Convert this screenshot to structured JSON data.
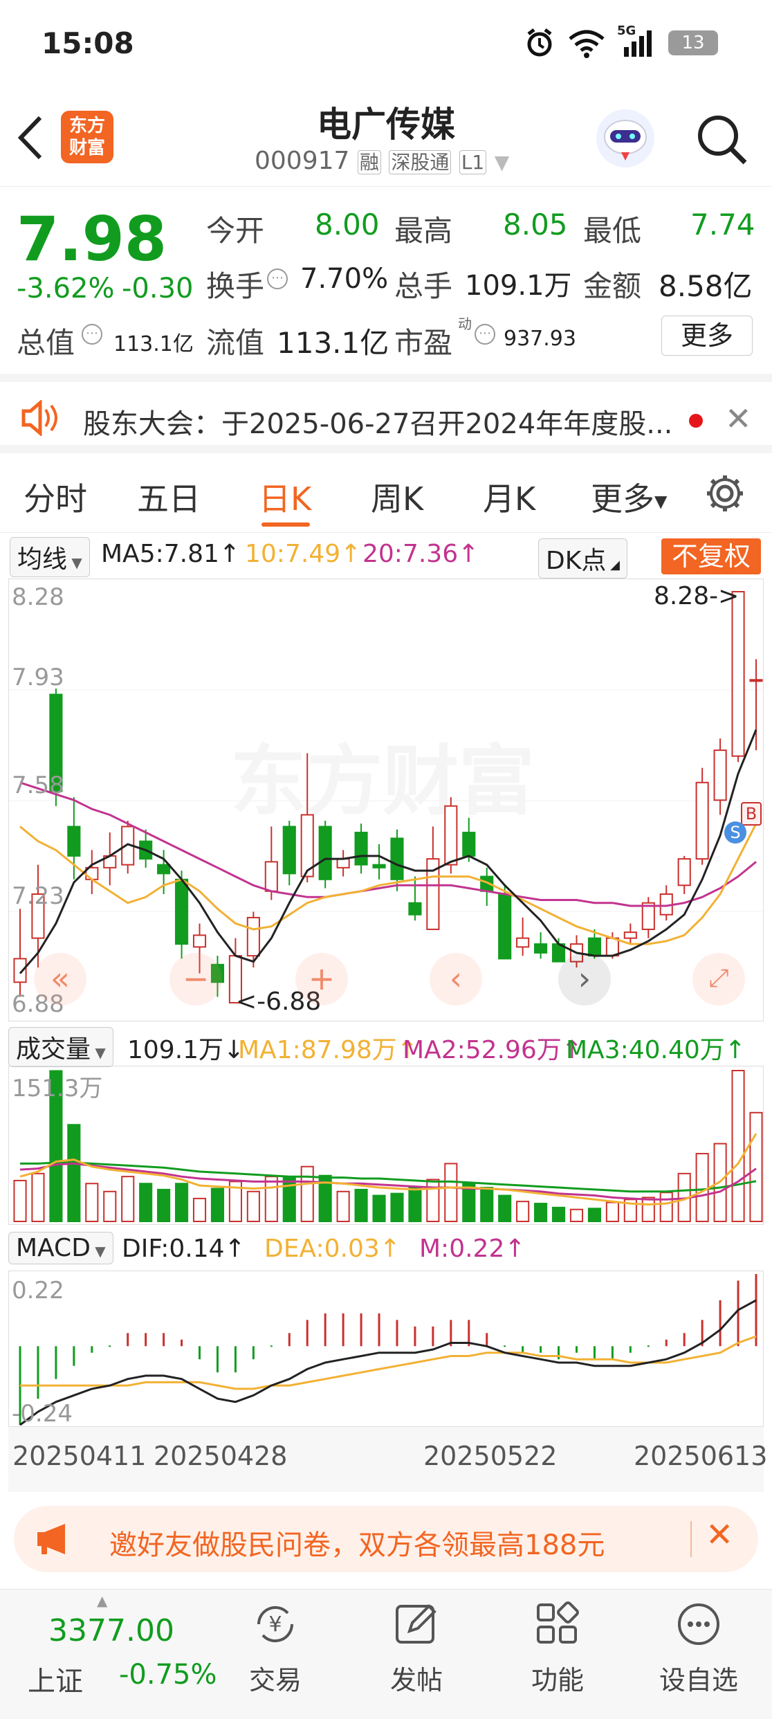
{
  "status_bar": {
    "time": "15:08",
    "battery": "13",
    "network": "5G"
  },
  "header": {
    "title": "电广传媒",
    "code": "000917",
    "tags": [
      "融",
      "深股通",
      "L1"
    ],
    "logo_text": "东方财富"
  },
  "quote": {
    "price": "7.98",
    "change_pct": "-3.62%",
    "change": "-0.30",
    "open_label": "今开",
    "open": "8.00",
    "high_label": "最高",
    "high": "8.05",
    "low_label": "最低",
    "low": "7.74",
    "turnover_label": "换手",
    "turnover": "7.70%",
    "volume_label": "总手",
    "volume": "109.1万",
    "amount_label": "金额",
    "amount": "8.58亿",
    "mktcap_label": "总值",
    "mktcap": "113.1亿",
    "float_label": "流值",
    "float": "113.1亿",
    "pe_label": "市盈",
    "pe_sup": "动",
    "pe": "937.93",
    "more_button": "更多"
  },
  "notice": {
    "text": "股东大会：于2025-06-27召开2024年年度股..."
  },
  "tabs": {
    "items": [
      "分时",
      "五日",
      "日K",
      "周K",
      "月K",
      "更多"
    ],
    "active": "日K"
  },
  "kline": {
    "ma_select": "均线",
    "ma5": "MA5:7.81↑",
    "ma10": "10:7.49↑",
    "ma20": "20:7.36↑",
    "dk_select": "DK点",
    "fq_button": "不复权",
    "y_labels": [
      "8.28",
      "7.93",
      "7.58",
      "7.23",
      "6.88"
    ],
    "max_marker": "8.28->",
    "min_marker": "<-6.88",
    "watermark": "东方财富",
    "b_mark": "B",
    "s_mark": "S"
  },
  "volume": {
    "select": "成交量",
    "value": "109.1万↓",
    "ma1": "MA1:87.98万↑",
    "ma2": "MA2:52.96万↑",
    "ma3": "MA3:40.40万↑",
    "ymax": "151.3万"
  },
  "macd": {
    "select": "MACD",
    "dif": "DIF:0.14↑",
    "dea": "DEA:0.03↑",
    "m": "M:0.22↑",
    "ymax": "0.22",
    "ymin": "-0.24"
  },
  "dates": [
    "20250411",
    "20250428",
    "20250522",
    "20250613"
  ],
  "banner": {
    "text": "邀好友做股民问卷，双方各领最高188元"
  },
  "bottom": {
    "index_value": "3377.00",
    "index_name": "上证",
    "index_change": "-0.75%",
    "items": [
      "交易",
      "发帖",
      "功能",
      "设自选"
    ]
  },
  "colors": {
    "up": "#c9302c",
    "down": "#119c1f",
    "accent": "#f26522",
    "ma5": "#222222",
    "ma10": "#f2b134",
    "ma20": "#c2338f"
  },
  "chart_data": {
    "type": "candlestick",
    "ylim": [
      6.88,
      8.28
    ],
    "candles": [
      {
        "o": 6.95,
        "c": 7.03,
        "h": 7.2,
        "l": 6.9
      },
      {
        "o": 7.1,
        "c": 7.25,
        "h": 7.35,
        "l": 7.0
      },
      {
        "o": 7.93,
        "c": 7.6,
        "h": 7.95,
        "l": 7.55
      },
      {
        "o": 7.48,
        "c": 7.38,
        "h": 7.58,
        "l": 7.3
      },
      {
        "o": 7.3,
        "c": 7.34,
        "h": 7.4,
        "l": 7.25
      },
      {
        "o": 7.34,
        "c": 7.38,
        "h": 7.46,
        "l": 7.28
      },
      {
        "o": 7.35,
        "c": 7.48,
        "h": 7.5,
        "l": 7.32
      },
      {
        "o": 7.43,
        "c": 7.37,
        "h": 7.47,
        "l": 7.34
      },
      {
        "o": 7.35,
        "c": 7.32,
        "h": 7.4,
        "l": 7.25
      },
      {
        "o": 7.3,
        "c": 7.08,
        "h": 7.33,
        "l": 7.03
      },
      {
        "o": 7.07,
        "c": 7.11,
        "h": 7.15,
        "l": 6.98
      },
      {
        "o": 7.01,
        "c": 6.95,
        "h": 7.04,
        "l": 6.9
      },
      {
        "o": 6.88,
        "c": 7.04,
        "h": 7.1,
        "l": 6.88
      },
      {
        "o": 7.04,
        "c": 7.17,
        "h": 7.19,
        "l": 7.0
      },
      {
        "o": 7.26,
        "c": 7.36,
        "h": 7.48,
        "l": 7.23
      },
      {
        "o": 7.48,
        "c": 7.32,
        "h": 7.5,
        "l": 7.28
      },
      {
        "o": 7.31,
        "c": 7.52,
        "h": 7.73,
        "l": 7.29
      },
      {
        "o": 7.48,
        "c": 7.3,
        "h": 7.5,
        "l": 7.27
      },
      {
        "o": 7.34,
        "c": 7.37,
        "h": 7.4,
        "l": 7.31
      },
      {
        "o": 7.46,
        "c": 7.35,
        "h": 7.49,
        "l": 7.32
      },
      {
        "o": 7.35,
        "c": 7.34,
        "h": 7.42,
        "l": 7.3
      },
      {
        "o": 7.44,
        "c": 7.3,
        "h": 7.47,
        "l": 7.26
      },
      {
        "o": 7.22,
        "c": 7.18,
        "h": 7.31,
        "l": 7.16
      },
      {
        "o": 7.13,
        "c": 7.37,
        "h": 7.48,
        "l": 7.13
      },
      {
        "o": 7.35,
        "c": 7.55,
        "h": 7.58,
        "l": 7.32
      },
      {
        "o": 7.46,
        "c": 7.38,
        "h": 7.51,
        "l": 7.36
      },
      {
        "o": 7.31,
        "c": 7.26,
        "h": 7.34,
        "l": 7.21
      },
      {
        "o": 7.25,
        "c": 7.03,
        "h": 7.28,
        "l": 7.03
      },
      {
        "o": 7.07,
        "c": 7.1,
        "h": 7.17,
        "l": 7.04
      },
      {
        "o": 7.08,
        "c": 7.05,
        "h": 7.12,
        "l": 7.03
      },
      {
        "o": 7.08,
        "c": 7.02,
        "h": 7.1,
        "l": 7.02
      },
      {
        "o": 7.02,
        "c": 7.08,
        "h": 7.11,
        "l": 7.0
      },
      {
        "o": 7.1,
        "c": 7.04,
        "h": 7.13,
        "l": 7.03
      },
      {
        "o": 7.04,
        "c": 7.1,
        "h": 7.12,
        "l": 7.03
      },
      {
        "o": 7.1,
        "c": 7.12,
        "h": 7.15,
        "l": 7.08
      },
      {
        "o": 7.13,
        "c": 7.22,
        "h": 7.24,
        "l": 7.1
      },
      {
        "o": 7.18,
        "c": 7.25,
        "h": 7.28,
        "l": 7.16
      },
      {
        "o": 7.28,
        "c": 7.37,
        "h": 7.38,
        "l": 7.25
      },
      {
        "o": 7.37,
        "c": 7.63,
        "h": 7.68,
        "l": 7.35
      },
      {
        "o": 7.57,
        "c": 7.74,
        "h": 7.78,
        "l": 7.52
      },
      {
        "o": 7.72,
        "c": 8.28,
        "h": 8.28,
        "l": 7.7
      },
      {
        "o": 7.98,
        "c": 7.98,
        "h": 8.05,
        "l": 7.74
      }
    ],
    "ma5": [
      6.98,
      7.05,
      7.15,
      7.29,
      7.35,
      7.38,
      7.42,
      7.4,
      7.37,
      7.3,
      7.22,
      7.12,
      7.04,
      7.02,
      7.1,
      7.22,
      7.33,
      7.37,
      7.37,
      7.38,
      7.38,
      7.35,
      7.33,
      7.33,
      7.36,
      7.38,
      7.35,
      7.28,
      7.22,
      7.16,
      7.08,
      7.05,
      7.04,
      7.04,
      7.06,
      7.09,
      7.13,
      7.18,
      7.3,
      7.45,
      7.66,
      7.81
    ],
    "ma10": [
      7.48,
      7.43,
      7.4,
      7.35,
      7.3,
      7.26,
      7.22,
      7.24,
      7.28,
      7.3,
      7.26,
      7.2,
      7.15,
      7.13,
      7.14,
      7.18,
      7.22,
      7.24,
      7.25,
      7.26,
      7.28,
      7.29,
      7.3,
      7.31,
      7.31,
      7.31,
      7.29,
      7.26,
      7.23,
      7.2,
      7.17,
      7.14,
      7.12,
      7.1,
      7.08,
      7.08,
      7.09,
      7.11,
      7.17,
      7.25,
      7.37,
      7.49
    ],
    "ma20": [
      7.63,
      7.61,
      7.59,
      7.57,
      7.54,
      7.52,
      7.49,
      7.46,
      7.43,
      7.4,
      7.37,
      7.34,
      7.31,
      7.28,
      7.26,
      7.25,
      7.24,
      7.24,
      7.25,
      7.26,
      7.27,
      7.28,
      7.28,
      7.28,
      7.28,
      7.27,
      7.26,
      7.25,
      7.24,
      7.23,
      7.23,
      7.23,
      7.22,
      7.22,
      7.21,
      7.21,
      7.21,
      7.22,
      7.24,
      7.27,
      7.31,
      7.36
    ],
    "volume_max": 151.3,
    "volumes": [
      41,
      48,
      151,
      97,
      38,
      30,
      45,
      38,
      32,
      38,
      23,
      33,
      40,
      30,
      45,
      45,
      55,
      46,
      30,
      32,
      26,
      28,
      35,
      42,
      58,
      38,
      34,
      26,
      20,
      18,
      14,
      12,
      13,
      19,
      22,
      24,
      29,
      48,
      68,
      78,
      151.3,
      109.1
    ],
    "vol_ma1": [
      45,
      50,
      60,
      62,
      55,
      52,
      50,
      48,
      46,
      42,
      36,
      35,
      34,
      33,
      34,
      36,
      38,
      39,
      38,
      36,
      34,
      33,
      32,
      33,
      34,
      34,
      33,
      32,
      30,
      28,
      26,
      24,
      22,
      20,
      18,
      17,
      18,
      22,
      30,
      40,
      58,
      87.98
    ],
    "vol_ma2": [
      52,
      53,
      57,
      58,
      56,
      54,
      52,
      50,
      48,
      45,
      43,
      42,
      41,
      40,
      40,
      40,
      40,
      39,
      38,
      38,
      37,
      36,
      35,
      34,
      34,
      33,
      33,
      32,
      31,
      30,
      28,
      27,
      26,
      24,
      23,
      22,
      22,
      23,
      26,
      30,
      40,
      52.96
    ],
    "vol_ma3": [
      58,
      58,
      59,
      59,
      58,
      57,
      56,
      55,
      54,
      52,
      50,
      49,
      48,
      47,
      46,
      45,
      45,
      44,
      44,
      43,
      43,
      42,
      41,
      40,
      40,
      39,
      38,
      37,
      36,
      35,
      34,
      33,
      32,
      31,
      30,
      30,
      30,
      31,
      32,
      34,
      37,
      40.4
    ],
    "macd_range": [
      -0.24,
      0.22
    ],
    "dif": [
      -0.24,
      -0.2,
      -0.17,
      -0.15,
      -0.13,
      -0.12,
      -0.1,
      -0.09,
      -0.09,
      -0.1,
      -0.13,
      -0.16,
      -0.17,
      -0.15,
      -0.12,
      -0.1,
      -0.07,
      -0.05,
      -0.04,
      -0.03,
      -0.02,
      -0.02,
      -0.02,
      -0.01,
      0.01,
      0.01,
      0.0,
      -0.02,
      -0.03,
      -0.04,
      -0.05,
      -0.05,
      -0.06,
      -0.06,
      -0.06,
      -0.05,
      -0.04,
      -0.02,
      0.01,
      0.05,
      0.11,
      0.14
    ],
    "dea": [
      -0.12,
      -0.12,
      -0.12,
      -0.12,
      -0.12,
      -0.12,
      -0.12,
      -0.11,
      -0.11,
      -0.11,
      -0.11,
      -0.12,
      -0.13,
      -0.13,
      -0.12,
      -0.12,
      -0.11,
      -0.1,
      -0.09,
      -0.08,
      -0.07,
      -0.06,
      -0.05,
      -0.04,
      -0.03,
      -0.03,
      -0.02,
      -0.02,
      -0.02,
      -0.03,
      -0.03,
      -0.04,
      -0.04,
      -0.04,
      -0.05,
      -0.05,
      -0.05,
      -0.04,
      -0.03,
      -0.02,
      0.01,
      0.03
    ],
    "macd": [
      -0.24,
      -0.16,
      -0.1,
      -0.06,
      -0.02,
      0.0,
      0.04,
      0.04,
      0.04,
      0.02,
      -0.04,
      -0.08,
      -0.08,
      -0.04,
      0.0,
      0.04,
      0.08,
      0.1,
      0.1,
      0.1,
      0.1,
      0.08,
      0.06,
      0.06,
      0.08,
      0.08,
      0.04,
      0.0,
      -0.02,
      -0.02,
      -0.04,
      -0.02,
      -0.04,
      -0.04,
      -0.02,
      0.0,
      0.02,
      0.04,
      0.08,
      0.14,
      0.2,
      0.22
    ]
  }
}
